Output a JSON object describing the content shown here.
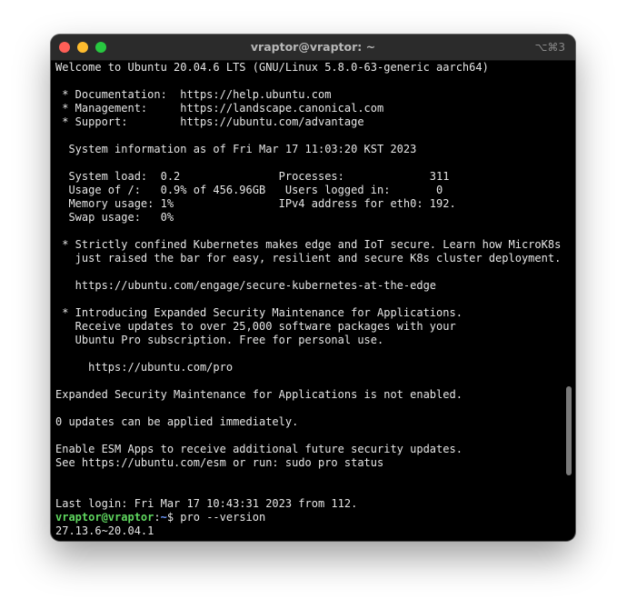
{
  "window": {
    "title": "vraptor@vraptor: ~",
    "shortcut": "⌥⌘3"
  },
  "terminal": {
    "lines": [
      "Welcome to Ubuntu 20.04.6 LTS (GNU/Linux 5.8.0-63-generic aarch64)",
      "",
      " * Documentation:  https://help.ubuntu.com",
      " * Management:     https://landscape.canonical.com",
      " * Support:        https://ubuntu.com/advantage",
      "",
      "  System information as of Fri Mar 17 11:03:20 KST 2023",
      "",
      "  System load:  0.2               Processes:             311",
      "  Usage of /:   0.9% of 456.96GB   Users logged in:       0",
      "  Memory usage: 1%                IPv4 address for eth0: 192.",
      "  Swap usage:   0%",
      "",
      " * Strictly confined Kubernetes makes edge and IoT secure. Learn how MicroK8s",
      "   just raised the bar for easy, resilient and secure K8s cluster deployment.",
      "",
      "   https://ubuntu.com/engage/secure-kubernetes-at-the-edge",
      "",
      " * Introducing Expanded Security Maintenance for Applications.",
      "   Receive updates to over 25,000 software packages with your",
      "   Ubuntu Pro subscription. Free for personal use.",
      "",
      "     https://ubuntu.com/pro",
      "",
      "Expanded Security Maintenance for Applications is not enabled.",
      "",
      "0 updates can be applied immediately.",
      "",
      "Enable ESM Apps to receive additional future security updates.",
      "See https://ubuntu.com/esm or run: sudo pro status",
      "",
      "",
      "Last login: Fri Mar 17 10:43:31 2023 from 112."
    ],
    "prompt": {
      "user_host": "vraptor@vraptor",
      "separator": ":",
      "path": "~",
      "symbol": "$ ",
      "command": "pro --version"
    },
    "output": "27.13.6~20.04.1"
  },
  "colors": {
    "background": "#000000",
    "text": "#e6e6e6",
    "prompt_user": "#5fd75f",
    "prompt_path": "#6f9bff",
    "titlebar": "#2b2b2b",
    "close": "#ff5f57",
    "minimize": "#febc2e",
    "maximize": "#28c840"
  }
}
